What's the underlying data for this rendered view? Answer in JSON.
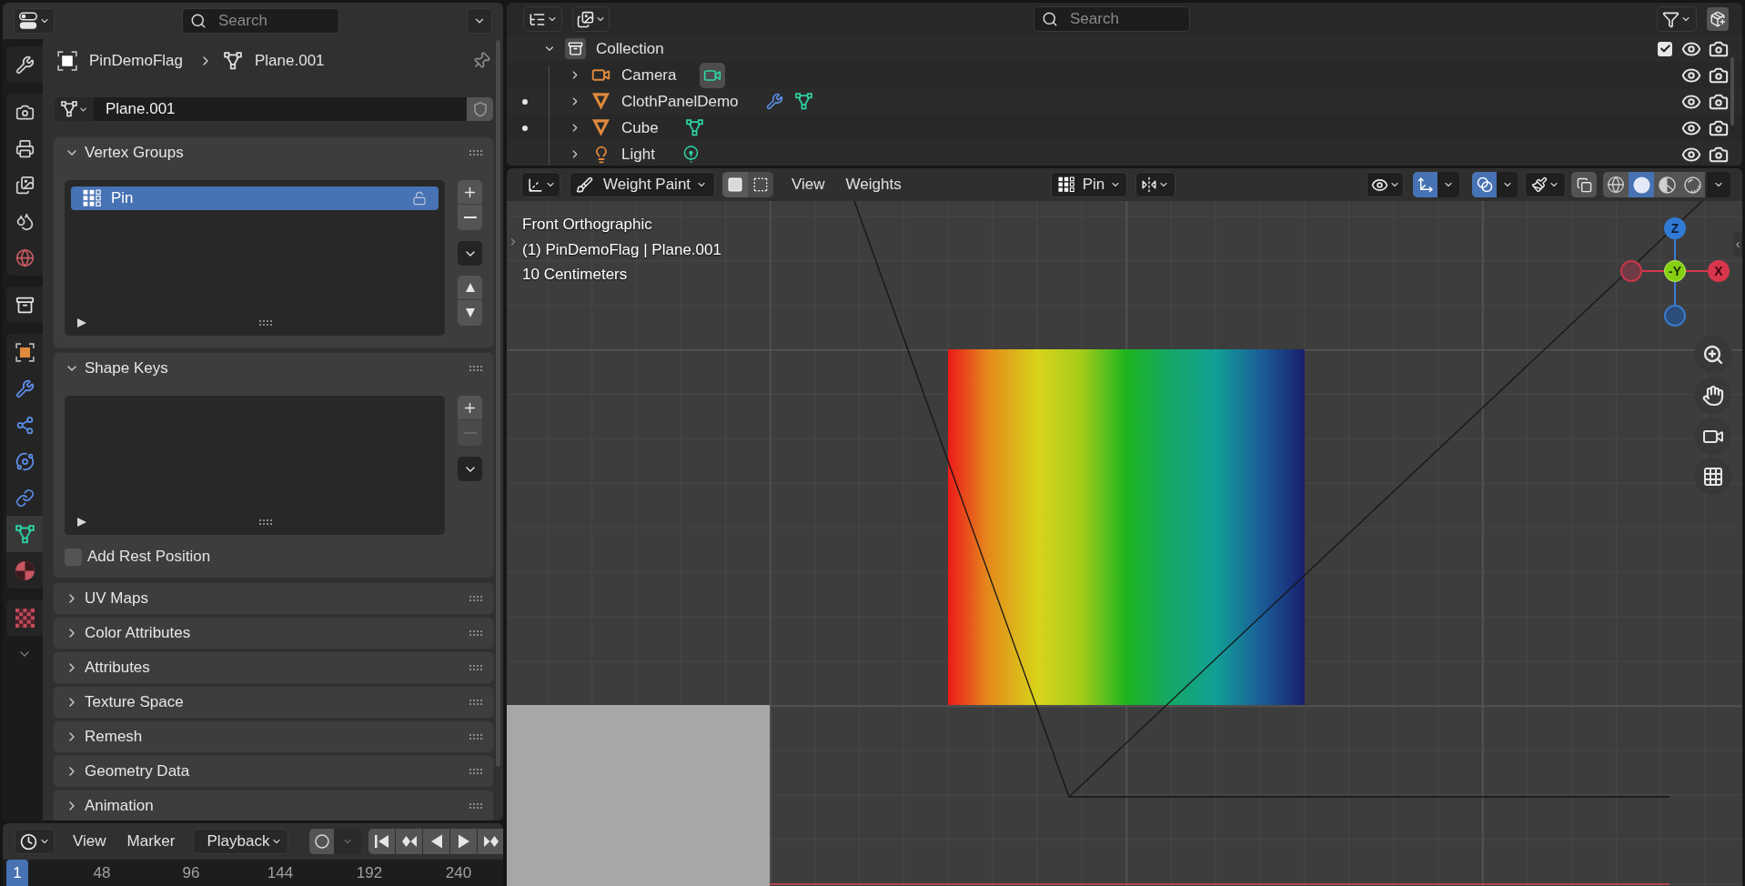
{
  "properties": {
    "search": {
      "placeholder": "Search"
    },
    "tab_groups": [
      {
        "tabs": [
          {
            "kind": "tool",
            "selected": false
          }
        ]
      },
      {
        "tabs": [
          {
            "kind": "render",
            "selected": false
          },
          {
            "kind": "output",
            "selected": false
          },
          {
            "kind": "viewlayer",
            "selected": false
          },
          {
            "kind": "scene",
            "selected": false
          },
          {
            "kind": "world",
            "selected": false
          }
        ]
      },
      {
        "tabs": [
          {
            "kind": "collection",
            "selected": false
          }
        ]
      },
      {
        "tabs": [
          {
            "kind": "object",
            "selected": false
          },
          {
            "kind": "modifiers",
            "selected": false
          },
          {
            "kind": "particles",
            "selected": false
          },
          {
            "kind": "physics",
            "selected": false
          },
          {
            "kind": "constraints",
            "selected": false
          },
          {
            "kind": "data",
            "selected": true
          },
          {
            "kind": "material",
            "selected": false
          }
        ]
      },
      {
        "tabs": [
          {
            "kind": "texture",
            "selected": false
          }
        ]
      }
    ],
    "breadcrumb": {
      "object": "PinDemoFlag",
      "data": "Plane.001"
    },
    "datablock": {
      "name": "Plane.001"
    },
    "panels": [
      {
        "title": "Vertex Groups",
        "expanded": true,
        "items": [
          {
            "name": "Pin",
            "selected": true,
            "locked": false
          }
        ]
      },
      {
        "title": "Shape Keys",
        "expanded": true,
        "checkbox": {
          "label": "Add Rest Position",
          "checked": false
        }
      },
      {
        "title": "UV Maps",
        "expanded": false
      },
      {
        "title": "Color Attributes",
        "expanded": false
      },
      {
        "title": "Attributes",
        "expanded": false
      },
      {
        "title": "Texture Space",
        "expanded": false
      },
      {
        "title": "Remesh",
        "expanded": false
      },
      {
        "title": "Geometry Data",
        "expanded": false
      },
      {
        "title": "Animation",
        "expanded": false
      }
    ]
  },
  "timeline": {
    "menus": [
      "View",
      "Marker"
    ],
    "playback": "Playback",
    "current_frame": "1",
    "ticks": [
      "48",
      "96",
      "144",
      "192",
      "240"
    ]
  },
  "outliner": {
    "search": {
      "placeholder": "Search"
    },
    "tree": [
      {
        "kind": "collection",
        "name": "Collection",
        "expanded": true,
        "checked": true,
        "visible": true,
        "renderable": true,
        "children": [
          {
            "kind": "camera",
            "name": "Camera",
            "expanded": false,
            "dot": false,
            "visible": true,
            "renderable": true,
            "badges": [
              {
                "kind": "camera",
                "selected": true
              }
            ]
          },
          {
            "kind": "mesh",
            "name": "ClothPanelDemo",
            "expanded": false,
            "dot": true,
            "visible": true,
            "renderable": true,
            "badges": [
              {
                "kind": "modifier",
                "selected": false
              },
              {
                "kind": "mesh",
                "selected": false
              }
            ]
          },
          {
            "kind": "mesh",
            "name": "Cube",
            "expanded": false,
            "dot": true,
            "visible": true,
            "renderable": true,
            "badges": [
              {
                "kind": "mesh",
                "selected": false
              }
            ]
          },
          {
            "kind": "light",
            "name": "Light",
            "expanded": false,
            "dot": false,
            "visible": true,
            "renderable": true,
            "badges": [
              {
                "kind": "light",
                "selected": false
              }
            ]
          }
        ]
      }
    ]
  },
  "viewport": {
    "mode": "Weight Paint",
    "menus": [
      "View",
      "Weights"
    ],
    "vertex_group": "Pin",
    "gizmos_on": true,
    "overlays_on": true,
    "shading": [
      {
        "kind": "wireframe",
        "selected": false
      },
      {
        "kind": "solid",
        "selected": true
      },
      {
        "kind": "material",
        "selected": false
      },
      {
        "kind": "rendered",
        "selected": false
      }
    ],
    "info": [
      "Front Orthographic",
      "(1) PinDemoFlag | Plane.001",
      "10 Centimeters"
    ],
    "gizmo": {
      "top": "Z",
      "center": "-Y",
      "right": "X"
    }
  }
}
